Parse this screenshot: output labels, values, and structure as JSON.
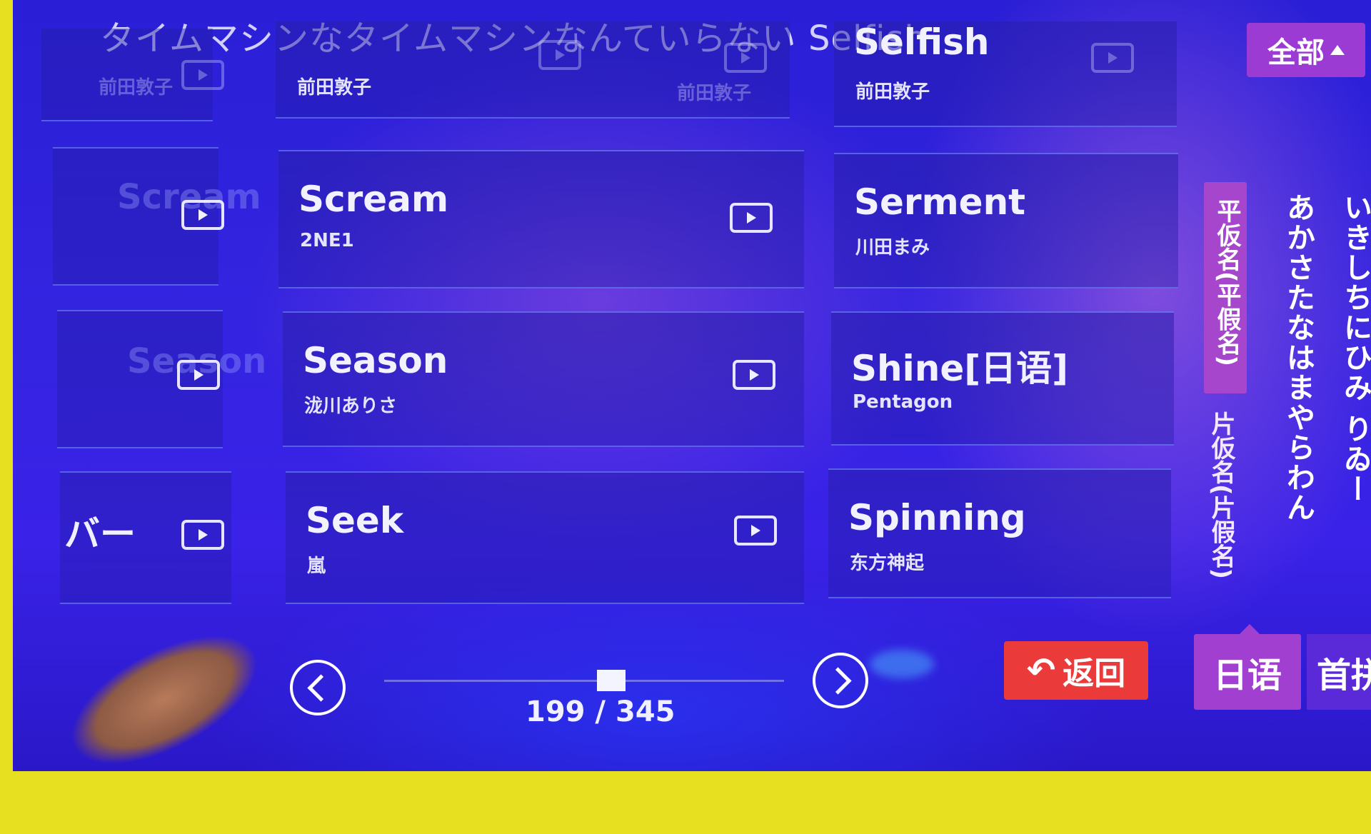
{
  "top_marquee": "タイムマシンなタイムマシンなんていらない Selfish",
  "filter": {
    "all_label": "全部"
  },
  "songs": [
    {
      "title": "Selfish",
      "artist": "前田敦子"
    },
    {
      "title": "Scream",
      "artist": "2NE1"
    },
    {
      "title": "Serment",
      "artist": "川田まみ"
    },
    {
      "title": "Season",
      "artist": "泷川ありさ"
    },
    {
      "title": "Shine[日语]",
      "artist": "Pentagon"
    },
    {
      "title": "Seek",
      "artist": "嵐"
    },
    {
      "title": "Spinning",
      "artist": "东方神起"
    }
  ],
  "prev_column": {
    "top_artist": "前田敦子",
    "ghost_titles": [
      "Scream",
      "Season"
    ],
    "bottom_label": "バー"
  },
  "faded_artist": "前田敦子",
  "kana": {
    "hiragana_label": "平仮名(平假名)",
    "katakana_label": "片仮名(片假名)",
    "col1": "あかさたなはまやらわん",
    "col2": "いきしちにひみ りゐー"
  },
  "pagination": {
    "text": "199 / 345",
    "current": 199,
    "total": 345
  },
  "back_label": "返回",
  "language_tab": "日语",
  "pinyin_tab": "首拼",
  "colors": {
    "back": "#ea3a3a",
    "accent": "#9b3bd3",
    "background": "#3324e0"
  }
}
